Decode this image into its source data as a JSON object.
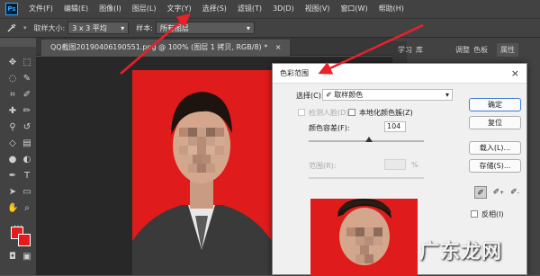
{
  "app": {
    "logo_text": "Ps"
  },
  "menu": [
    "文件(F)",
    "编辑(E)",
    "图像(I)",
    "图层(L)",
    "文字(Y)",
    "选择(S)",
    "滤镜(T)",
    "3D(D)",
    "视图(V)",
    "窗口(W)",
    "帮助(H)"
  ],
  "options_bar": {
    "sample_size_label": "取样大小:",
    "sample_size_value": "3 x 3 平均",
    "sample_label": "样本:",
    "sample_value": "所有图层"
  },
  "document_tab": {
    "title": "QQ截图20190406190551.png @ 100% (图层 1 拷贝, RGB/8) *",
    "close": "×"
  },
  "right_panel": {
    "tabs": [
      "学习",
      "库",
      "调整",
      "色板",
      "属性"
    ]
  },
  "dialog": {
    "title": "色彩范围",
    "close": "×",
    "select_label": "选择(C):",
    "select_value": "取样颜色",
    "detect_faces_label": "检测人脸(D)",
    "localized_label": "本地化颜色簇(Z)",
    "fuzziness_label": "颜色容差(F):",
    "fuzziness_value": "104",
    "fuzziness_fraction": 0.52,
    "range_label": "范围(R):",
    "range_unit": "%",
    "buttons": {
      "ok": "确定",
      "reset": "复位",
      "load": "载入(L)...",
      "save": "存储(S)..."
    },
    "invert_label": "反相(I)"
  },
  "colors": {
    "foreground": "#e51b1b",
    "background": "#e51b1b",
    "photo_bg": "#e01b1b",
    "annotation_arrow": "#e8212a"
  },
  "watermark": "广东龙网"
}
